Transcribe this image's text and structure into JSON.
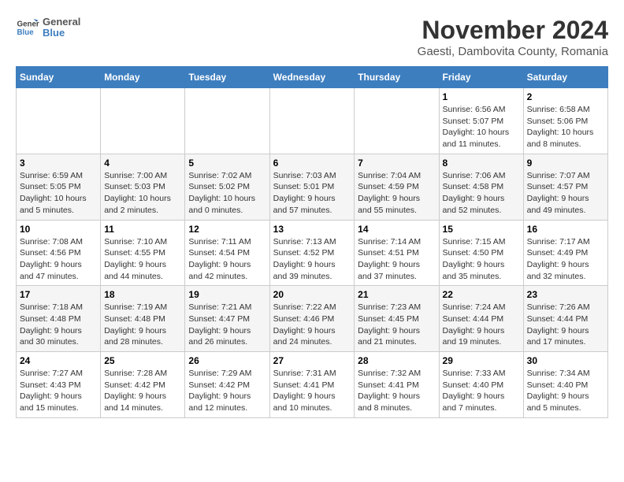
{
  "logo": {
    "name": "General",
    "name2": "Blue"
  },
  "title": "November 2024",
  "subtitle": "Gaesti, Dambovita County, Romania",
  "days_of_week": [
    "Sunday",
    "Monday",
    "Tuesday",
    "Wednesday",
    "Thursday",
    "Friday",
    "Saturday"
  ],
  "weeks": [
    [
      {
        "day": "",
        "info": ""
      },
      {
        "day": "",
        "info": ""
      },
      {
        "day": "",
        "info": ""
      },
      {
        "day": "",
        "info": ""
      },
      {
        "day": "",
        "info": ""
      },
      {
        "day": "1",
        "info": "Sunrise: 6:56 AM\nSunset: 5:07 PM\nDaylight: 10 hours and 11 minutes."
      },
      {
        "day": "2",
        "info": "Sunrise: 6:58 AM\nSunset: 5:06 PM\nDaylight: 10 hours and 8 minutes."
      }
    ],
    [
      {
        "day": "3",
        "info": "Sunrise: 6:59 AM\nSunset: 5:05 PM\nDaylight: 10 hours and 5 minutes."
      },
      {
        "day": "4",
        "info": "Sunrise: 7:00 AM\nSunset: 5:03 PM\nDaylight: 10 hours and 2 minutes."
      },
      {
        "day": "5",
        "info": "Sunrise: 7:02 AM\nSunset: 5:02 PM\nDaylight: 10 hours and 0 minutes."
      },
      {
        "day": "6",
        "info": "Sunrise: 7:03 AM\nSunset: 5:01 PM\nDaylight: 9 hours and 57 minutes."
      },
      {
        "day": "7",
        "info": "Sunrise: 7:04 AM\nSunset: 4:59 PM\nDaylight: 9 hours and 55 minutes."
      },
      {
        "day": "8",
        "info": "Sunrise: 7:06 AM\nSunset: 4:58 PM\nDaylight: 9 hours and 52 minutes."
      },
      {
        "day": "9",
        "info": "Sunrise: 7:07 AM\nSunset: 4:57 PM\nDaylight: 9 hours and 49 minutes."
      }
    ],
    [
      {
        "day": "10",
        "info": "Sunrise: 7:08 AM\nSunset: 4:56 PM\nDaylight: 9 hours and 47 minutes."
      },
      {
        "day": "11",
        "info": "Sunrise: 7:10 AM\nSunset: 4:55 PM\nDaylight: 9 hours and 44 minutes."
      },
      {
        "day": "12",
        "info": "Sunrise: 7:11 AM\nSunset: 4:54 PM\nDaylight: 9 hours and 42 minutes."
      },
      {
        "day": "13",
        "info": "Sunrise: 7:13 AM\nSunset: 4:52 PM\nDaylight: 9 hours and 39 minutes."
      },
      {
        "day": "14",
        "info": "Sunrise: 7:14 AM\nSunset: 4:51 PM\nDaylight: 9 hours and 37 minutes."
      },
      {
        "day": "15",
        "info": "Sunrise: 7:15 AM\nSunset: 4:50 PM\nDaylight: 9 hours and 35 minutes."
      },
      {
        "day": "16",
        "info": "Sunrise: 7:17 AM\nSunset: 4:49 PM\nDaylight: 9 hours and 32 minutes."
      }
    ],
    [
      {
        "day": "17",
        "info": "Sunrise: 7:18 AM\nSunset: 4:48 PM\nDaylight: 9 hours and 30 minutes."
      },
      {
        "day": "18",
        "info": "Sunrise: 7:19 AM\nSunset: 4:48 PM\nDaylight: 9 hours and 28 minutes."
      },
      {
        "day": "19",
        "info": "Sunrise: 7:21 AM\nSunset: 4:47 PM\nDaylight: 9 hours and 26 minutes."
      },
      {
        "day": "20",
        "info": "Sunrise: 7:22 AM\nSunset: 4:46 PM\nDaylight: 9 hours and 24 minutes."
      },
      {
        "day": "21",
        "info": "Sunrise: 7:23 AM\nSunset: 4:45 PM\nDaylight: 9 hours and 21 minutes."
      },
      {
        "day": "22",
        "info": "Sunrise: 7:24 AM\nSunset: 4:44 PM\nDaylight: 9 hours and 19 minutes."
      },
      {
        "day": "23",
        "info": "Sunrise: 7:26 AM\nSunset: 4:44 PM\nDaylight: 9 hours and 17 minutes."
      }
    ],
    [
      {
        "day": "24",
        "info": "Sunrise: 7:27 AM\nSunset: 4:43 PM\nDaylight: 9 hours and 15 minutes."
      },
      {
        "day": "25",
        "info": "Sunrise: 7:28 AM\nSunset: 4:42 PM\nDaylight: 9 hours and 14 minutes."
      },
      {
        "day": "26",
        "info": "Sunrise: 7:29 AM\nSunset: 4:42 PM\nDaylight: 9 hours and 12 minutes."
      },
      {
        "day": "27",
        "info": "Sunrise: 7:31 AM\nSunset: 4:41 PM\nDaylight: 9 hours and 10 minutes."
      },
      {
        "day": "28",
        "info": "Sunrise: 7:32 AM\nSunset: 4:41 PM\nDaylight: 9 hours and 8 minutes."
      },
      {
        "day": "29",
        "info": "Sunrise: 7:33 AM\nSunset: 4:40 PM\nDaylight: 9 hours and 7 minutes."
      },
      {
        "day": "30",
        "info": "Sunrise: 7:34 AM\nSunset: 4:40 PM\nDaylight: 9 hours and 5 minutes."
      }
    ]
  ]
}
